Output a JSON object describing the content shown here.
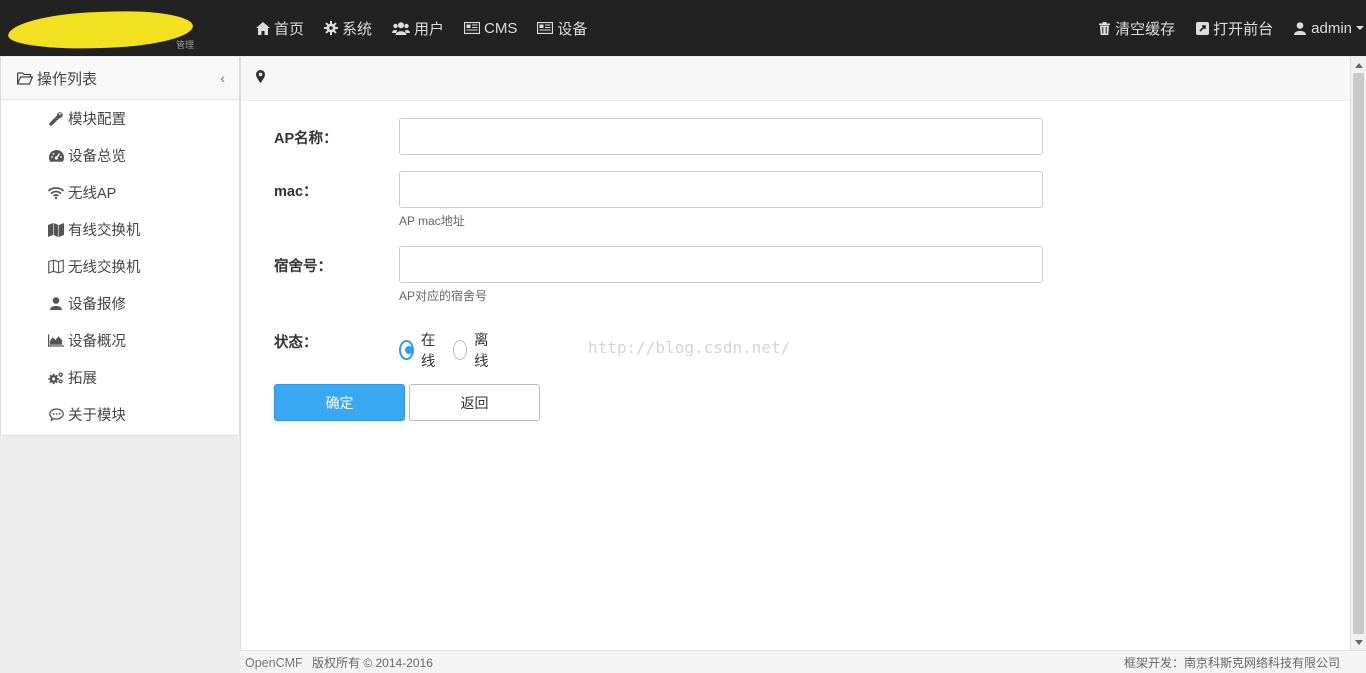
{
  "topbar": {
    "logo_text": "管理",
    "nav_left": [
      {
        "label": "首页",
        "icon": "home-icon"
      },
      {
        "label": "系统",
        "icon": "gear-icon"
      },
      {
        "label": "用户",
        "icon": "users-icon"
      },
      {
        "label": "CMS",
        "icon": "newspaper-icon"
      },
      {
        "label": "设备",
        "icon": "newspaper-icon"
      }
    ],
    "nav_right": [
      {
        "label": "清空缓存",
        "icon": "trash-icon"
      },
      {
        "label": "打开前台",
        "icon": "external-link-icon"
      },
      {
        "label": "admin",
        "icon": "user-icon"
      }
    ]
  },
  "sidebar": {
    "title": "操作列表",
    "items": [
      {
        "label": "模块配置",
        "icon": "wrench-icon"
      },
      {
        "label": "设备总览",
        "icon": "dashboard-icon"
      },
      {
        "label": "无线AP",
        "icon": "wifi-icon"
      },
      {
        "label": "有线交换机",
        "icon": "map-icon"
      },
      {
        "label": "无线交换机",
        "icon": "map-outline-icon"
      },
      {
        "label": "设备报修",
        "icon": "user-icon"
      },
      {
        "label": "设备概况",
        "icon": "area-chart-icon"
      },
      {
        "label": "拓展",
        "icon": "cogs-icon"
      },
      {
        "label": "关于模块",
        "icon": "comments-icon"
      }
    ]
  },
  "form": {
    "ap_name": {
      "label": "AP名称：",
      "value": ""
    },
    "mac": {
      "label": "mac：",
      "value": "",
      "help": "AP mac地址"
    },
    "dorm": {
      "label": "宿舍号：",
      "value": "",
      "help": "AP对应的宿舍号"
    },
    "status": {
      "label": "状态：",
      "options": [
        "在线",
        "离线"
      ],
      "selected": "在线"
    },
    "submit_label": "确定",
    "back_label": "返回"
  },
  "watermark": "http://blog.csdn.net/",
  "footer": {
    "brand": "OpenCMF",
    "copyright": "版权所有 © 2014-2016",
    "developer": "框架开发：南京科斯克网络科技有限公司"
  },
  "colors": {
    "topbar_bg": "#222222",
    "primary": "#3aa7f2",
    "radio_checked": "#2e9bf0"
  }
}
